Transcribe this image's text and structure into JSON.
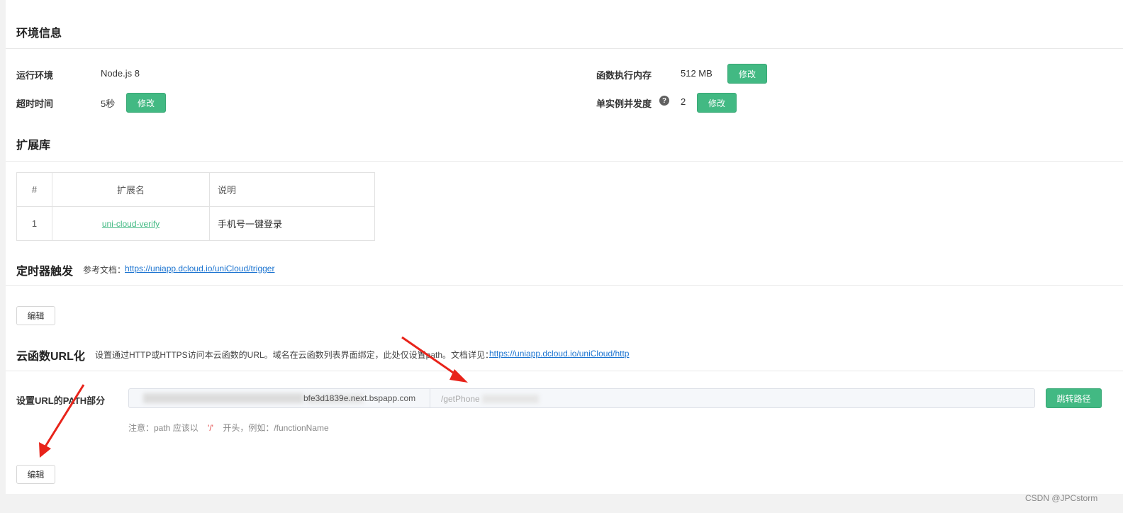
{
  "env": {
    "title": "环境信息",
    "runtime_label": "运行环境",
    "runtime_value": "Node.js 8",
    "timeout_label": "超时时间",
    "timeout_value": "5秒",
    "memory_label": "函数执行内存",
    "memory_value": "512 MB",
    "concurrency_label": "单实例并发度",
    "concurrency_value": "2",
    "edit_label": "修改"
  },
  "extensions": {
    "title": "扩展库",
    "headers": [
      "#",
      "扩展名",
      "说明"
    ],
    "rows": [
      {
        "index": "1",
        "name": "uni-cloud-verify",
        "desc": "手机号一键登录"
      }
    ]
  },
  "timer": {
    "title": "定时器触发",
    "doc_prefix": "参考文档：",
    "doc_link": "https://uniapp.dcloud.io/uniCloud/trigger",
    "edit_label": "编辑"
  },
  "url": {
    "title": "云函数URL化",
    "desc": "设置通过HTTP或HTTPS访问本云函数的URL。域名在云函数列表界面绑定，此处仅设置path。文档详见：",
    "doc_link": "https://uniapp.dcloud.io/uniCloud/http",
    "path_label": "设置URL的PATH部分",
    "domain_value": "bfe3d1839e.next.bspapp.com",
    "path_value": "/getPhone",
    "jump_label": "跳转路径",
    "hint_prefix": "注意：path 应该以",
    "hint_slash": "'/'",
    "hint_suffix": "开头，例如：/functionName",
    "edit_label": "编辑"
  },
  "watermark": "CSDN @JPCstorm",
  "colors": {
    "accent": "#42b983",
    "link": "#1a73d0",
    "arrow": "#e8231a"
  }
}
